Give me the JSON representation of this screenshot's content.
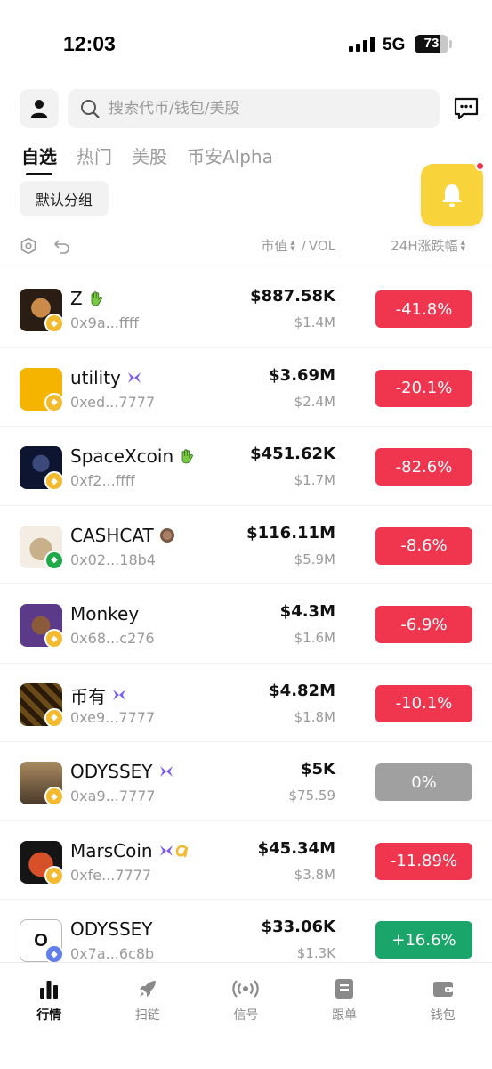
{
  "status_bar": {
    "time": "12:03",
    "network": "5G",
    "battery": "73",
    "battery_level": 0.73
  },
  "header": {
    "search_placeholder": "搜索代币/钱包/美股",
    "icons": {
      "profile": "user-icon",
      "search": "search-icon",
      "messages": "message-icon"
    }
  },
  "tabs": [
    {
      "label": "自选",
      "active": true
    },
    {
      "label": "热门",
      "active": false
    },
    {
      "label": "美股",
      "active": false
    },
    {
      "label": "币安Alpha",
      "active": false
    }
  ],
  "group_button": "默认分组",
  "floating": {
    "icon": "bell-icon",
    "color": "#f8d33a",
    "has_notification": true
  },
  "columns": {
    "mcap": "市值",
    "separator": "/",
    "vol": "VOL",
    "change": "24H涨跌幅",
    "tools": [
      "settings-hex-icon",
      "undo-icon"
    ]
  },
  "tokens": [
    {
      "name": "Z",
      "tag_icon": "waving-hand-icon",
      "address": "0x9a...ffff",
      "mcap": "$887.58K",
      "vol": "$1.4M",
      "change": "-41.8%",
      "direction": "down",
      "chain": "bnb"
    },
    {
      "name": "utility",
      "tag_icon": "butterfly-icon",
      "address": "0xed...7777",
      "mcap": "$3.69M",
      "vol": "$2.4M",
      "change": "-20.1%",
      "direction": "down",
      "chain": "bnb"
    },
    {
      "name": "SpaceXcoin",
      "tag_icon": "waving-hand-icon",
      "address": "0xf2...ffff",
      "mcap": "$451.62K",
      "vol": "$1.7M",
      "change": "-82.6%",
      "direction": "down",
      "chain": "bnb"
    },
    {
      "name": "CASHCAT",
      "tag_icon": "coin-icon",
      "address": "0x02...18b4",
      "mcap": "$116.11M",
      "vol": "$5.9M",
      "change": "-8.6%",
      "direction": "down",
      "chain": "green"
    },
    {
      "name": "Monkey",
      "tag_icon": "",
      "address": "0x68...c276",
      "mcap": "$4.3M",
      "vol": "$1.6M",
      "change": "-6.9%",
      "direction": "down",
      "chain": "bnb"
    },
    {
      "name": "币有",
      "tag_icon": "butterfly-icon",
      "address": "0xe9...7777",
      "mcap": "$4.82M",
      "vol": "$1.8M",
      "change": "-10.1%",
      "direction": "down",
      "chain": "bnb"
    },
    {
      "name": "ODYSSEY",
      "tag_icon": "butterfly-icon",
      "address": "0xa9...7777",
      "mcap": "$5K",
      "vol": "$75.59",
      "change": "0%",
      "direction": "flat",
      "chain": "bnb"
    },
    {
      "name": "MarsCoin",
      "tag_icon": "butterfly-alpha-icon",
      "address": "0xfe...7777",
      "mcap": "$45.34M",
      "vol": "$3.8M",
      "change": "-11.89%",
      "direction": "down",
      "chain": "bnb"
    },
    {
      "name": "ODYSSEY",
      "tag_icon": "",
      "address": "0x7a...6c8b",
      "mcap": "$33.06K",
      "vol": "$1.3K",
      "change": "+16.6%",
      "direction": "up",
      "chain": "eth",
      "logo_letter": "O"
    }
  ],
  "bottom_nav": [
    {
      "label": "行情",
      "icon": "chart-bars-icon",
      "active": true
    },
    {
      "label": "扫链",
      "icon": "rocket-icon",
      "active": false
    },
    {
      "label": "信号",
      "icon": "broadcast-icon",
      "active": false
    },
    {
      "label": "跟单",
      "icon": "document-icon",
      "active": false
    },
    {
      "label": "钱包",
      "icon": "wallet-icon",
      "active": false
    }
  ],
  "colors": {
    "down": "#f0354f",
    "up": "#1aa66a",
    "flat": "#a0a0a0",
    "accent": "#f8d33a",
    "muted": "#9a9a9a"
  }
}
